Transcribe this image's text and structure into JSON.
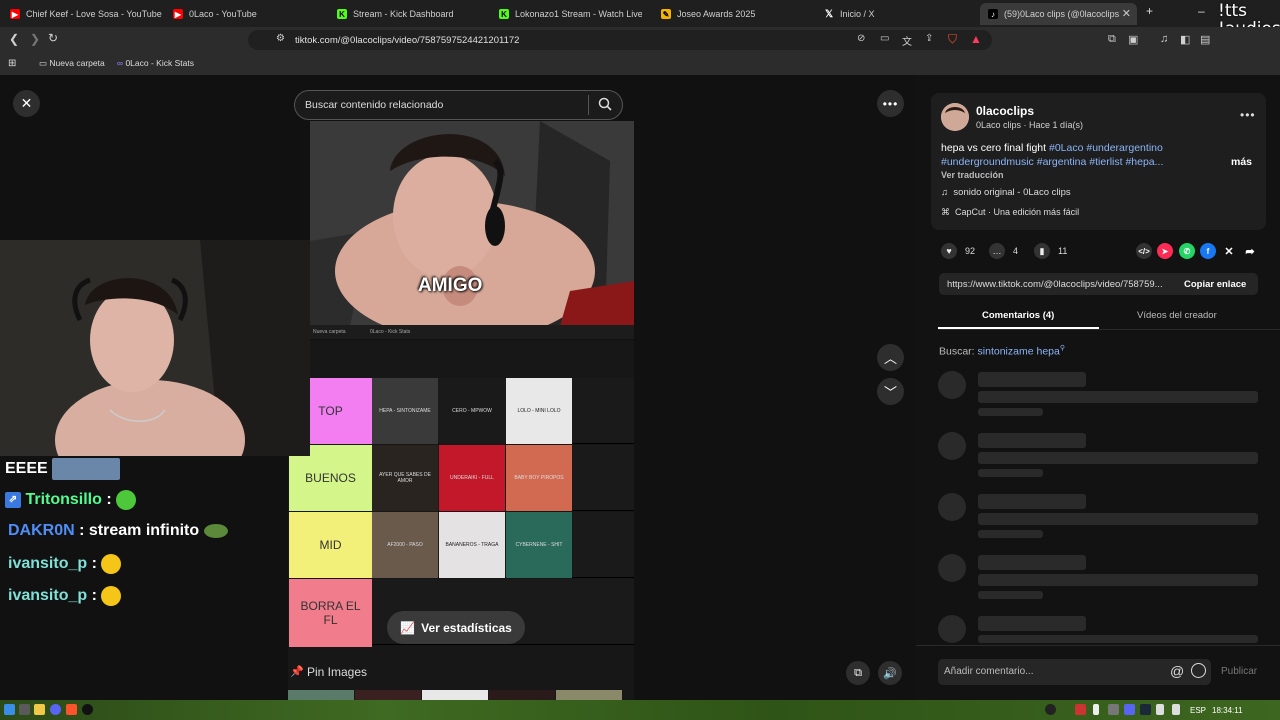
{
  "browser": {
    "tabs": [
      {
        "title": "Chief Keef - Love Sosa - YouTube",
        "icon": "youtube-icon",
        "color": "#ff0000"
      },
      {
        "title": "0Laco - YouTube",
        "icon": "youtube-icon",
        "color": "#ff0000"
      },
      {
        "title": "Stream - Kick Dashboard",
        "icon": "kick-icon",
        "color": "#53fc18"
      },
      {
        "title": "Lokonazo1 Stream - Watch Live on K",
        "icon": "kick-icon",
        "color": "#53fc18"
      },
      {
        "title": "Joseo Awards 2025",
        "icon": "pencil-icon",
        "color": "#f4b400"
      },
      {
        "title": "Inicio / X",
        "icon": "x-icon",
        "color": "#000000"
      },
      {
        "title": "(59)0Laco clips (@0lacoclips)",
        "icon": "tiktok-icon",
        "color": "#000000"
      }
    ],
    "url": "tiktok.com/@0lacoclips/video/7587597524421201172",
    "bookmarks": [
      {
        "label": "Nueva carpeta",
        "icon": "folder-icon"
      },
      {
        "label": "0Laco - Kick Stats",
        "icon": "kick-stats-icon"
      }
    ],
    "overlay_text": [
      "!tts",
      "!audios"
    ]
  },
  "video": {
    "search_placeholder": "Buscar contenido relacionado",
    "caption": "AMIGO",
    "inner_bookmarks": [
      "Nueva carpeta",
      "0Laco - Kick Stats"
    ],
    "tierlist": [
      {
        "label": "TOP",
        "color": "#f27ef2",
        "items": [
          "HEPA - SINTONIZAME",
          "CERO - MPWOW",
          "LOLO - MINI LOLO"
        ]
      },
      {
        "label": "BUENOS",
        "color": "#d4f58a",
        "items": [
          "AYER QUE SABES DE AMOR",
          "UNDERAIKI - FULL",
          "BABY BOY PIROPOS"
        ]
      },
      {
        "label": "MID",
        "color": "#f3f07a",
        "items": [
          "AF2000 - PASO",
          "BANANEROS - TRAGA",
          "CYBERNENE - SHIT"
        ]
      },
      {
        "label": "BORRA EL FL",
        "color": "#f07c8c",
        "items": []
      }
    ],
    "stats_button": "Ver estadísticas",
    "pin_label": "Pin Images"
  },
  "chat": [
    {
      "user": "EEEE",
      "text": "",
      "user_color": "#ffffff"
    },
    {
      "user": "Tritonsillo",
      "text": ":",
      "user_color": "#53fc90"
    },
    {
      "user": "DAKR0N",
      "text": ": stream infinito",
      "user_color": "#4f8ef7"
    },
    {
      "user": "ivansito_p",
      "text": ":",
      "user_color": "#7fe0d8"
    },
    {
      "user": "ivansito_p",
      "text": ":",
      "user_color": "#7fe0d8"
    }
  ],
  "post": {
    "username": "0lacoclips",
    "meta": "0Laco clips · Hace 1 día(s)",
    "desc_text": "hepa vs cero final fight",
    "tags_line1": "#0Laco #underargentino",
    "tags_line2": "#undergroundmusic #argentina #tierlist #hepa...",
    "more": "más",
    "translate": "Ver traducción",
    "sound": "sonido original - 0Laco clips",
    "capcut": "CapCut · Una edición más fácil",
    "likes": "92",
    "comments": "4",
    "saves": "11",
    "link": "https://www.tiktok.com/@0lacoclips/video/758759...",
    "copy": "Copiar enlace",
    "tab_comments": "Comentarios (4)",
    "tab_videos": "Vídeos del creador",
    "search_label": "Buscar:",
    "search_term": "sintonizame hepa",
    "comment_placeholder": "Añadir comentario...",
    "publish": "Publicar"
  },
  "taskbar": {
    "lang": "ESP",
    "time": "18:34:11"
  }
}
